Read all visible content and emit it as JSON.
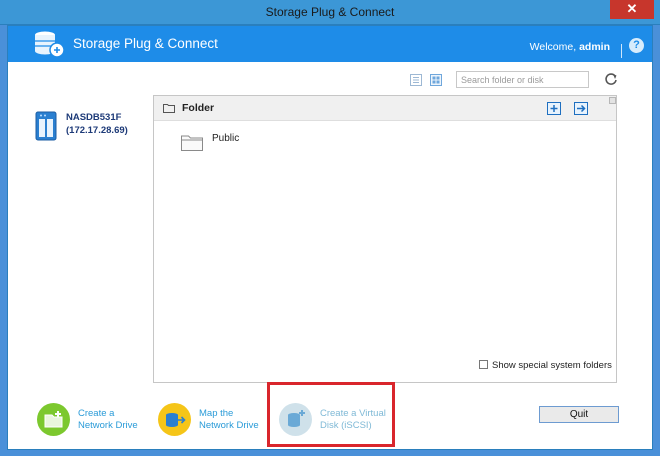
{
  "window": {
    "title": "Storage Plug & Connect",
    "close_label": "✕"
  },
  "header": {
    "app_title": "Storage Plug & Connect",
    "welcome_prefix": "Welcome,",
    "username": "admin",
    "help_label": "?"
  },
  "toolbar": {
    "search_placeholder": "Search folder or disk"
  },
  "device": {
    "name": "NASDB531F",
    "ip": "(172.17.28.69)"
  },
  "folder_panel": {
    "title": "Folder",
    "folders": [
      "Public"
    ],
    "show_system_label": "Show special system folders"
  },
  "actions": {
    "create_network_drive": [
      "Create a",
      "Network Drive"
    ],
    "map_network_drive": [
      "Map the",
      "Network Drive"
    ],
    "create_virtual_disk": [
      "Create a Virtual",
      "Disk (iSCSI)"
    ]
  },
  "buttons": {
    "quit": "Quit"
  },
  "colors": {
    "accent": "#1e8ce8",
    "highlight": "#d9262c",
    "create_network": "#7cc82e",
    "map_network": "#f5c518"
  }
}
